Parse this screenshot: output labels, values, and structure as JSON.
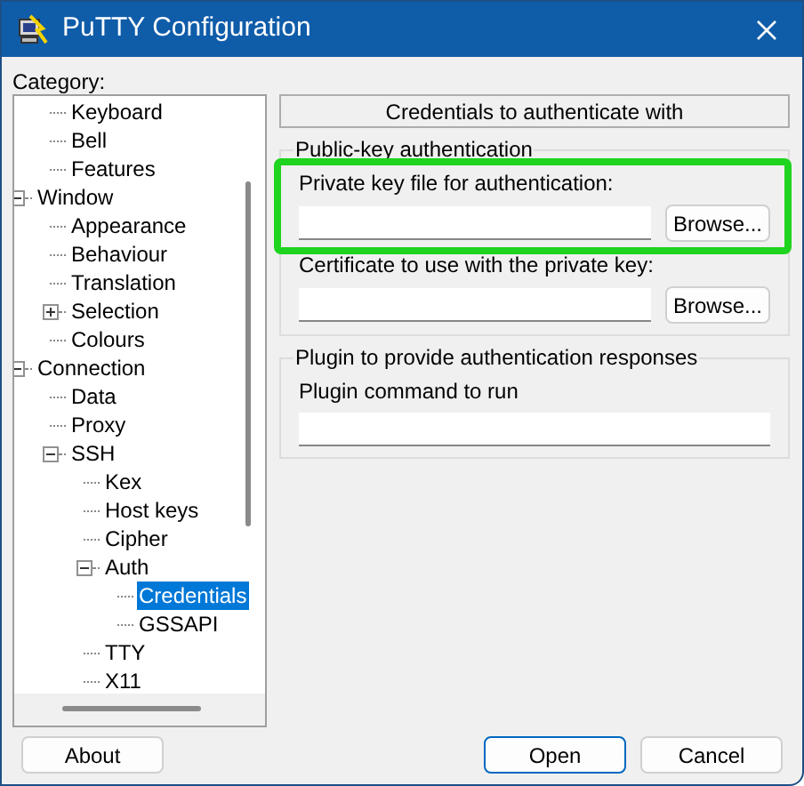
{
  "window": {
    "title": "PuTTY Configuration"
  },
  "category_label": "Category:",
  "tree": [
    {
      "children": [
        {
          "label": "Keyboard",
          "selected": false
        },
        {
          "label": "Bell",
          "selected": false
        },
        {
          "label": "Features",
          "selected": false
        }
      ]
    },
    {
      "label": "Window",
      "selected": false,
      "expanded": true,
      "children": [
        {
          "label": "Appearance",
          "selected": false
        },
        {
          "label": "Behaviour",
          "selected": false
        },
        {
          "label": "Translation",
          "selected": false
        },
        {
          "label": "Selection",
          "selected": false,
          "expanded": false
        },
        {
          "label": "Colours",
          "selected": false
        }
      ]
    },
    {
      "label": "Connection",
      "selected": false,
      "expanded": true,
      "children": [
        {
          "label": "Data",
          "selected": false
        },
        {
          "label": "Proxy",
          "selected": false
        },
        {
          "label": "SSH",
          "selected": false,
          "expanded": true,
          "children": [
            {
              "label": "Kex",
              "selected": false
            },
            {
              "label": "Host keys",
              "selected": false
            },
            {
              "label": "Cipher",
              "selected": false
            },
            {
              "label": "Auth",
              "selected": false,
              "expanded": true,
              "children": [
                {
                  "label": "Credentials",
                  "selected": true
                },
                {
                  "label": "GSSAPI",
                  "selected": false
                }
              ]
            },
            {
              "label": "TTY",
              "selected": false
            },
            {
              "label": "X11",
              "selected": false
            }
          ]
        }
      ]
    }
  ],
  "panel": {
    "header": "Credentials to authenticate with",
    "groups": [
      {
        "title": "Public-key authentication",
        "fields": [
          {
            "label": "Private key file for authentication:",
            "button": "Browse...",
            "highlighted": true
          },
          {
            "label": "Certificate to use with the private key:",
            "button": "Browse...",
            "highlighted": false
          }
        ]
      },
      {
        "title": "Plugin to provide authentication responses",
        "fields": [
          {
            "label": "Plugin command to run",
            "highlighted": false
          }
        ]
      }
    ]
  },
  "left_buttons": [
    {
      "label": "About",
      "default": false
    }
  ],
  "right_buttons": [
    {
      "label": "Open",
      "default": true
    },
    {
      "label": "Cancel",
      "default": false
    }
  ]
}
